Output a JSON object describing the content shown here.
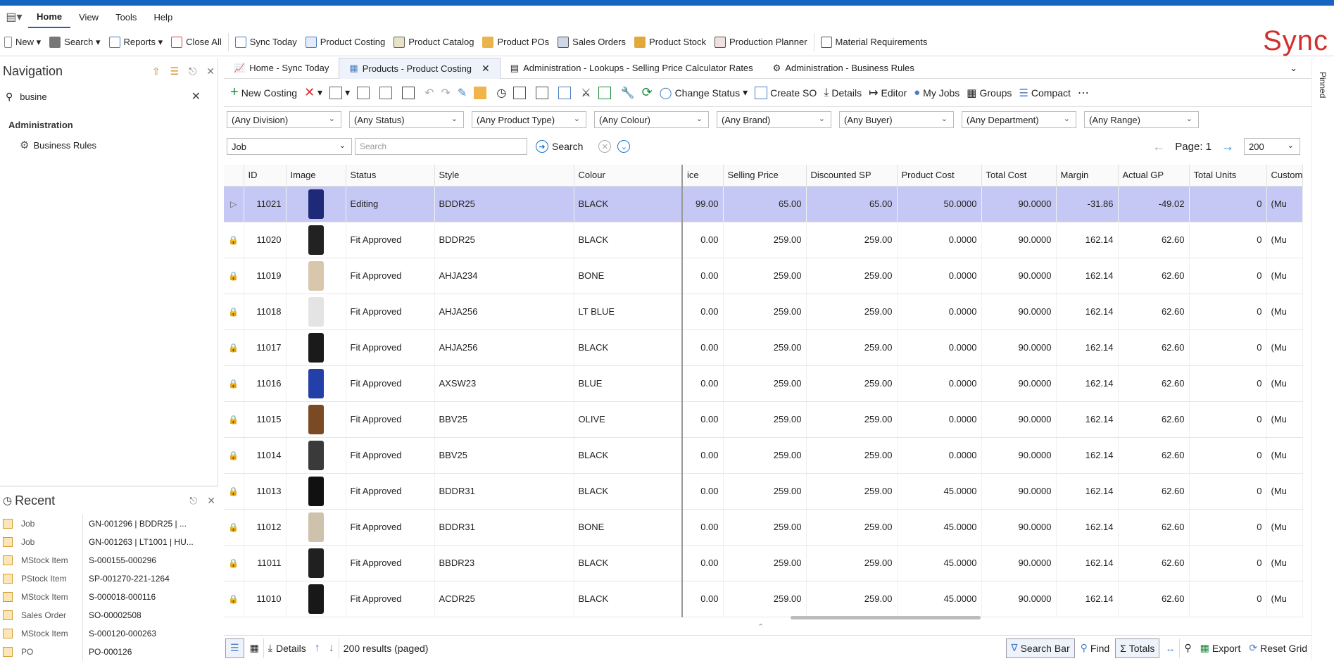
{
  "menubar": {
    "items": [
      "Home",
      "View",
      "Tools",
      "Help"
    ]
  },
  "ribbon": {
    "new": "New",
    "search": "Search",
    "reports": "Reports",
    "close_all": "Close All",
    "sync_today": "Sync Today",
    "product_costing": "Product Costing",
    "product_catalog": "Product Catalog",
    "product_pos": "Product POs",
    "sales_orders": "Sales Orders",
    "product_stock": "Product Stock",
    "production_planner": "Production Planner",
    "material_requirements": "Material Requirements"
  },
  "logo": "Sync",
  "navigation": {
    "title": "Navigation",
    "search_value": "busine",
    "group": "Administration",
    "item": "Business Rules"
  },
  "recent": {
    "title": "Recent",
    "rows": [
      {
        "type": "Job",
        "value": "GN-001296 |  BDDR25 | ..."
      },
      {
        "type": "Job",
        "value": "GN-001263 | LT1001 | HU..."
      },
      {
        "type": "MStock Item",
        "value": "S-000155-000296"
      },
      {
        "type": "PStock Item",
        "value": "SP-001270-221-1264"
      },
      {
        "type": "MStock Item",
        "value": "S-000018-000116"
      },
      {
        "type": "Sales Order",
        "value": "SO-00002508"
      },
      {
        "type": "MStock Item",
        "value": "S-000120-000263"
      },
      {
        "type": "PO",
        "value": "PO-000126"
      }
    ]
  },
  "tabs": [
    {
      "label": "Home - Sync Today"
    },
    {
      "label": "Products - Product Costing"
    },
    {
      "label": "Administration - Lookups - Selling Price Calculator Rates"
    },
    {
      "label": "Administration - Business Rules"
    }
  ],
  "toolbar": {
    "new_costing": "New Costing",
    "change_status": "Change Status",
    "create_so": "Create SO",
    "details": "Details",
    "editor": "Editor",
    "my_jobs": "My Jobs",
    "groups": "Groups",
    "compact": "Compact"
  },
  "filters": [
    "(Any Division)",
    "(Any Status)",
    "(Any Product Type)",
    "(Any Colour)",
    "(Any Brand)",
    "(Any Buyer)",
    "(Any Department)",
    "(Any Range)"
  ],
  "search": {
    "field": "Job",
    "placeholder": "Search",
    "button": "Search"
  },
  "pager": {
    "label": "Page: 1",
    "page_size": "200"
  },
  "grid": {
    "columns": [
      "ID",
      "Image",
      "Status",
      "Style",
      "Colour",
      "ice",
      "Selling Price",
      "Discounted SP",
      "Product Cost",
      "Total Cost",
      "Margin",
      "Actual GP",
      "Total Units",
      "Custom"
    ],
    "rows": [
      {
        "id": "11021",
        "status": "Editing",
        "style": "BDDR25",
        "colour": "BLACK",
        "ice": "99.00",
        "sp": "65.00",
        "dsp": "65.00",
        "pc": "50.0000",
        "tc": "90.0000",
        "margin": "-31.86",
        "gp": "-49.02",
        "units": "0",
        "custom": "(Mu",
        "thumb": "#1e2a78"
      },
      {
        "id": "11020",
        "status": "Fit Approved",
        "style": "BDDR25",
        "colour": "BLACK",
        "ice": "0.00",
        "sp": "259.00",
        "dsp": "259.00",
        "pc": "0.0000",
        "tc": "90.0000",
        "margin": "162.14",
        "gp": "62.60",
        "units": "0",
        "custom": "(Mu",
        "thumb": "#222222"
      },
      {
        "id": "11019",
        "status": "Fit Approved",
        "style": "AHJA234",
        "colour": "BONE",
        "ice": "0.00",
        "sp": "259.00",
        "dsp": "259.00",
        "pc": "0.0000",
        "tc": "90.0000",
        "margin": "162.14",
        "gp": "62.60",
        "units": "0",
        "custom": "(Mu",
        "thumb": "#d8c7ad"
      },
      {
        "id": "11018",
        "status": "Fit Approved",
        "style": "AHJA256",
        "colour": "LT BLUE",
        "ice": "0.00",
        "sp": "259.00",
        "dsp": "259.00",
        "pc": "0.0000",
        "tc": "90.0000",
        "margin": "162.14",
        "gp": "62.60",
        "units": "0",
        "custom": "(Mu",
        "thumb": "#e4e4e4"
      },
      {
        "id": "11017",
        "status": "Fit Approved",
        "style": "AHJA256",
        "colour": "BLACK",
        "ice": "0.00",
        "sp": "259.00",
        "dsp": "259.00",
        "pc": "0.0000",
        "tc": "90.0000",
        "margin": "162.14",
        "gp": "62.60",
        "units": "0",
        "custom": "(Mu",
        "thumb": "#1a1a1a"
      },
      {
        "id": "11016",
        "status": "Fit Approved",
        "style": "AXSW23",
        "colour": "BLUE",
        "ice": "0.00",
        "sp": "259.00",
        "dsp": "259.00",
        "pc": "0.0000",
        "tc": "90.0000",
        "margin": "162.14",
        "gp": "62.60",
        "units": "0",
        "custom": "(Mu",
        "thumb": "#2340a8"
      },
      {
        "id": "11015",
        "status": "Fit Approved",
        "style": "BBV25",
        "colour": "OLIVE",
        "ice": "0.00",
        "sp": "259.00",
        "dsp": "259.00",
        "pc": "0.0000",
        "tc": "90.0000",
        "margin": "162.14",
        "gp": "62.60",
        "units": "0",
        "custom": "(Mu",
        "thumb": "#7a4a24"
      },
      {
        "id": "11014",
        "status": "Fit Approved",
        "style": "BBV25",
        "colour": "BLACK",
        "ice": "0.00",
        "sp": "259.00",
        "dsp": "259.00",
        "pc": "0.0000",
        "tc": "90.0000",
        "margin": "162.14",
        "gp": "62.60",
        "units": "0",
        "custom": "(Mu",
        "thumb": "#3a3a3a"
      },
      {
        "id": "11013",
        "status": "Fit Approved",
        "style": "BDDR31",
        "colour": "BLACK",
        "ice": "0.00",
        "sp": "259.00",
        "dsp": "259.00",
        "pc": "45.0000",
        "tc": "90.0000",
        "margin": "162.14",
        "gp": "62.60",
        "units": "0",
        "custom": "(Mu",
        "thumb": "#111111"
      },
      {
        "id": "11012",
        "status": "Fit Approved",
        "style": "BDDR31",
        "colour": "BONE",
        "ice": "0.00",
        "sp": "259.00",
        "dsp": "259.00",
        "pc": "45.0000",
        "tc": "90.0000",
        "margin": "162.14",
        "gp": "62.60",
        "units": "0",
        "custom": "(Mu",
        "thumb": "#cfc2ad"
      },
      {
        "id": "11011",
        "status": "Fit Approved",
        "style": "BBDR23",
        "colour": "BLACK",
        "ice": "0.00",
        "sp": "259.00",
        "dsp": "259.00",
        "pc": "45.0000",
        "tc": "90.0000",
        "margin": "162.14",
        "gp": "62.60",
        "units": "0",
        "custom": "(Mu",
        "thumb": "#202020"
      },
      {
        "id": "11010",
        "status": "Fit Approved",
        "style": "ACDR25",
        "colour": "BLACK",
        "ice": "0.00",
        "sp": "259.00",
        "dsp": "259.00",
        "pc": "45.0000",
        "tc": "90.0000",
        "margin": "162.14",
        "gp": "62.60",
        "units": "0",
        "custom": "(Mu",
        "thumb": "#181818"
      }
    ]
  },
  "bottombar": {
    "details": "Details",
    "results": "200 results (paged)",
    "search_bar": "Search Bar",
    "find": "Find",
    "totals": "Totals",
    "export": "Export",
    "reset_grid": "Reset Grid"
  },
  "sidetab": "Pinned"
}
